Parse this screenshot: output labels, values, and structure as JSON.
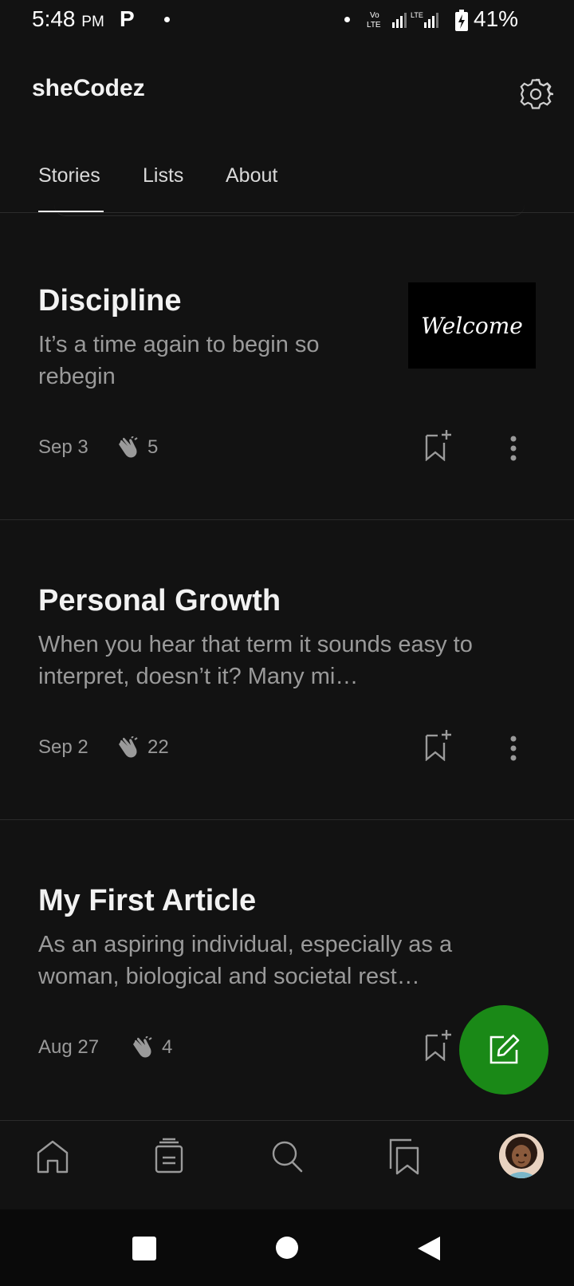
{
  "status_bar": {
    "time": "5:48",
    "ampm": "PM",
    "battery": "41%"
  },
  "header": {
    "title": "sheCodez"
  },
  "tabs": [
    {
      "label": "Stories",
      "active": true
    },
    {
      "label": "Lists",
      "active": false
    },
    {
      "label": "About",
      "active": false
    }
  ],
  "stories": [
    {
      "title": "Discipline",
      "subtitle": "It’s a time again to begin so rebegin",
      "date": "Sep 3",
      "claps": "5",
      "thumbnail_text": "Welcome"
    },
    {
      "title": "Personal Growth",
      "subtitle": "When you hear that term it sounds easy to interpret, doesn’t it? Many mi…",
      "date": "Sep 2",
      "claps": "22"
    },
    {
      "title": "My First Article",
      "subtitle": "As an aspiring individual, especially as a woman, biological and societal rest…",
      "date": "Aug 27",
      "claps": "4"
    }
  ],
  "colors": {
    "background": "#121212",
    "accent_green": "#1a8917",
    "text_primary": "#f2f2f2",
    "text_secondary": "#9a9a9a"
  },
  "icons": {
    "settings": "gear-icon",
    "clap": "clap-icon",
    "bookmark": "bookmark-add-icon",
    "more": "more-vertical-icon",
    "write": "edit-icon",
    "nav": [
      "home-icon",
      "feed-icon",
      "search-icon",
      "bookmarks-icon"
    ]
  }
}
